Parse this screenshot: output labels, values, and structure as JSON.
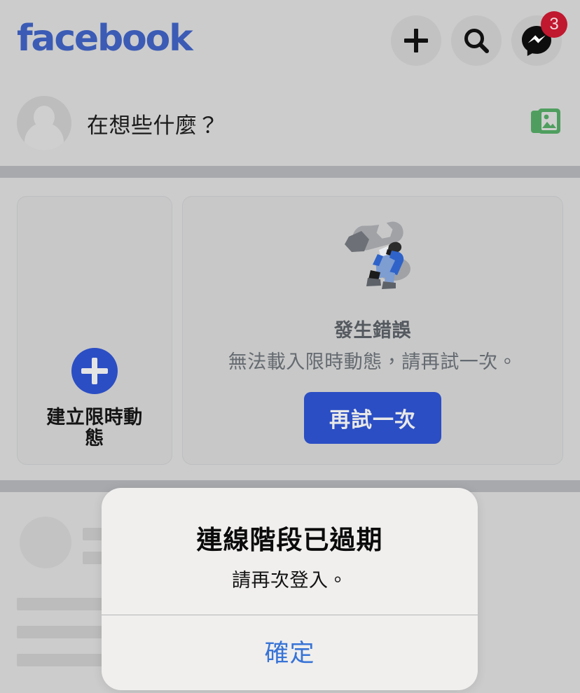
{
  "app": {
    "brand": "facebook",
    "brand_color": "#3b5bb5",
    "background_color": "#cccccc"
  },
  "header": {
    "actions": [
      {
        "name": "create-button",
        "icon": "plus-icon",
        "label": "建立"
      },
      {
        "name": "search-button",
        "icon": "search-icon",
        "label": "搜尋"
      },
      {
        "name": "messenger-button",
        "icon": "messenger-icon",
        "label": "Messenger",
        "badge": "3",
        "badge_color": "#c0182f"
      }
    ]
  },
  "composer": {
    "avatar_alt": "個人大頭貼照",
    "placeholder": "在想些什麼？",
    "photo_icon_label": "相片",
    "photo_icon_color": "#4f9e5f"
  },
  "stories": {
    "create": {
      "label": "建立限時動態",
      "plus_color": "#2b4ec4"
    },
    "error": {
      "title": "發生錯誤",
      "subtitle": "無法載入限時動態，請再試一次。",
      "retry_label": "再試一次",
      "retry_color": "#2b4ec4",
      "illustration": "wrench-worker-illustration"
    }
  },
  "feed": {
    "state": "loading-skeleton"
  },
  "modal": {
    "title": "連線階段已過期",
    "message": "請再次登入。",
    "confirm_label": "確定",
    "confirm_color": "#3874d6"
  }
}
